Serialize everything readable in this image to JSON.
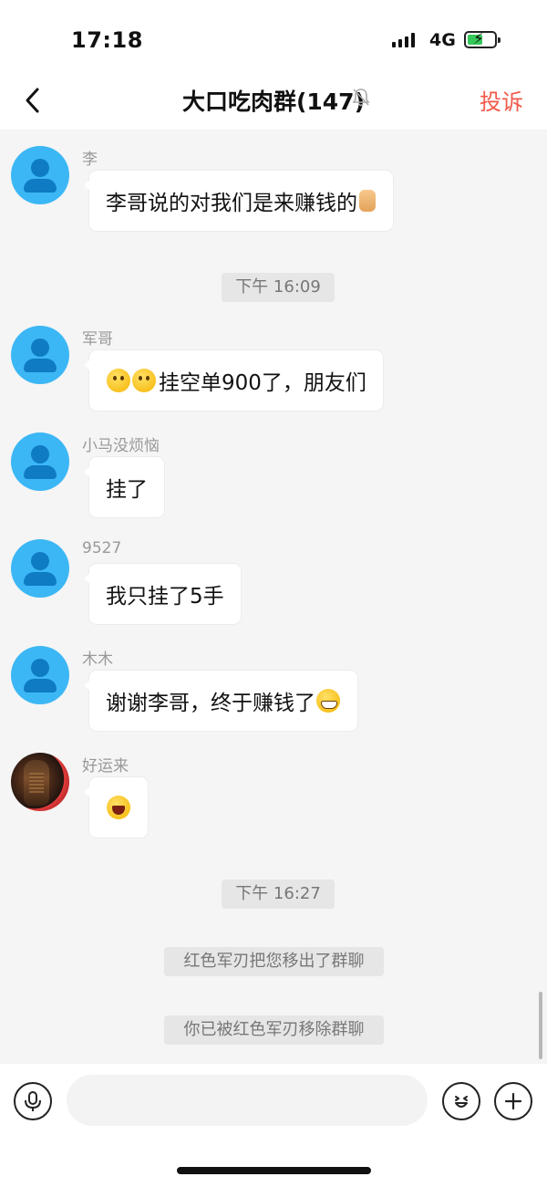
{
  "status_bar": {
    "time": "17:18",
    "network": "4G"
  },
  "nav": {
    "title": "大口吃肉群(147)",
    "action_label": "投诉"
  },
  "messages": [
    {
      "sender": "李",
      "pre_text": "李哥说的对我们是来赚钱的",
      "post_text": "",
      "emoji_before": [],
      "emoji_after": [
        "thumbs-up"
      ]
    },
    {
      "sender": "军哥",
      "pre_text": "",
      "post_text": "挂空单900了，朋友们",
      "emoji_before": [
        "thinking",
        "thinking"
      ],
      "emoji_after": []
    },
    {
      "sender": "小马没烦恼",
      "pre_text": "挂了",
      "post_text": "",
      "emoji_before": [],
      "emoji_after": []
    },
    {
      "sender": "9527",
      "pre_text": "我只挂了5手",
      "post_text": "",
      "emoji_before": [],
      "emoji_after": []
    },
    {
      "sender": "木木",
      "pre_text": "谢谢李哥，终于赚钱了",
      "post_text": "",
      "emoji_before": [],
      "emoji_after": [
        "grinning"
      ]
    },
    {
      "sender": "好运来",
      "pre_text": "",
      "post_text": "",
      "emoji_before": [],
      "emoji_after": [
        "laughing"
      ]
    }
  ],
  "timestamps": [
    "下午 16:09",
    "下午 16:27"
  ],
  "system_notices": [
    "红色军刃把您移出了群聊",
    "你已被红色军刃移除群聊"
  ],
  "input": {
    "placeholder": ""
  },
  "icons": {
    "back": "chevron-left-icon",
    "mute": "bell-slash-icon",
    "voice": "microphone-icon",
    "emoji": "smiley-icon",
    "more": "plus-icon"
  },
  "colors": {
    "accent": "#f15a4a",
    "avatar_bg": "#3cb7f5",
    "chat_bg": "#f5f5f5",
    "battery": "#34c759"
  }
}
